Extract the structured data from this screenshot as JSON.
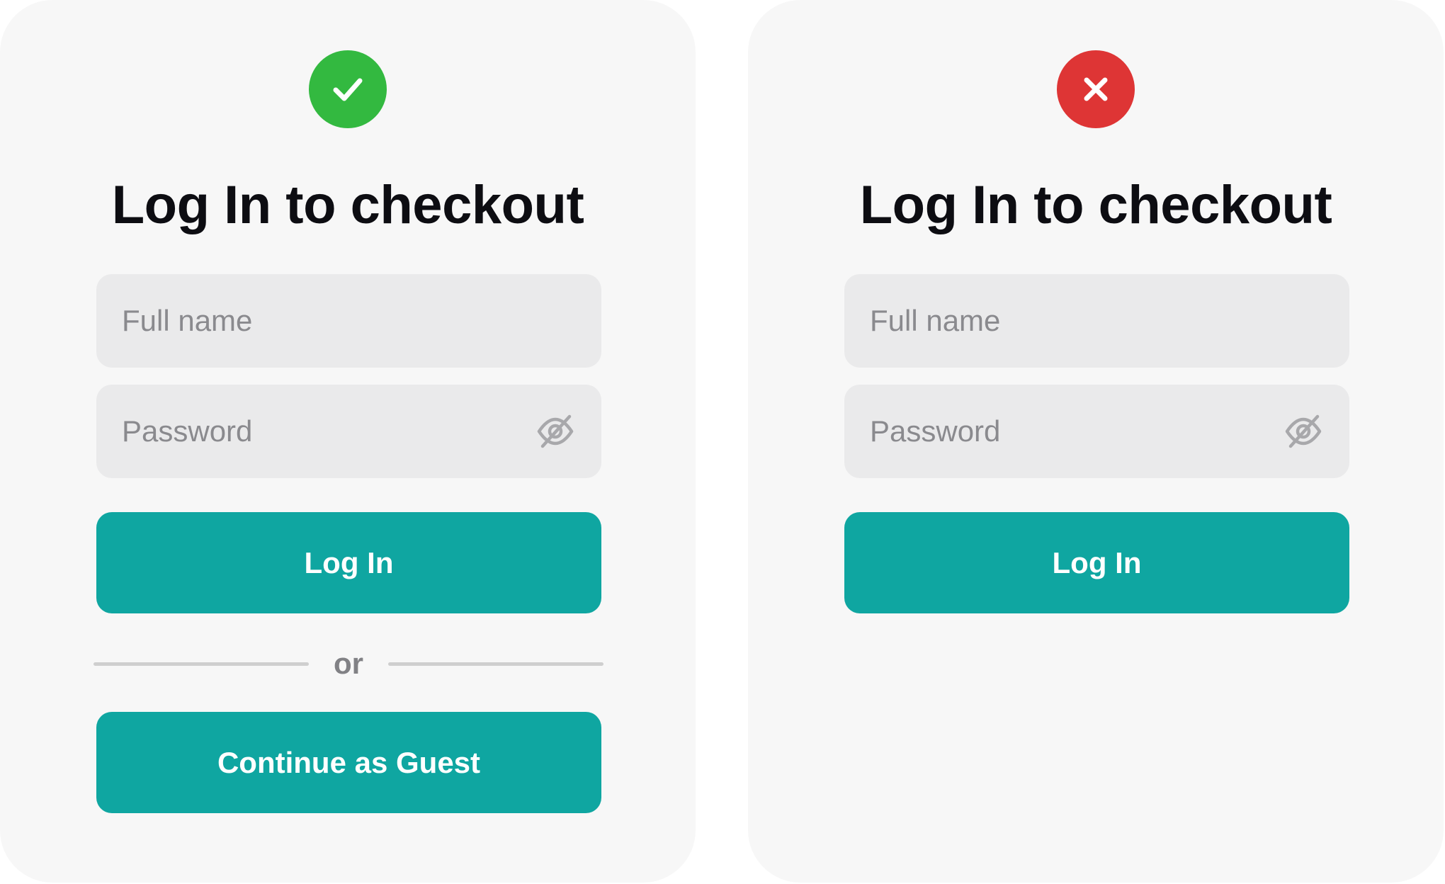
{
  "colors": {
    "card_bg": "#f7f7f7",
    "field_bg": "#eaeaeb",
    "button_bg": "#0fa6a1",
    "success": "#33b940",
    "error": "#de3535",
    "title": "#0d0d12"
  },
  "good_example": {
    "status_icon": "check-icon",
    "title": "Log In to checkout",
    "full_name_placeholder": "Full name",
    "password_placeholder": "Password",
    "password_toggle_icon": "eye-off-icon",
    "login_label": "Log In",
    "divider_text": "or",
    "guest_label": "Continue as Guest"
  },
  "bad_example": {
    "status_icon": "x-icon",
    "title": "Log In to checkout",
    "full_name_placeholder": "Full name",
    "password_placeholder": "Password",
    "password_toggle_icon": "eye-off-icon",
    "login_label": "Log In"
  }
}
